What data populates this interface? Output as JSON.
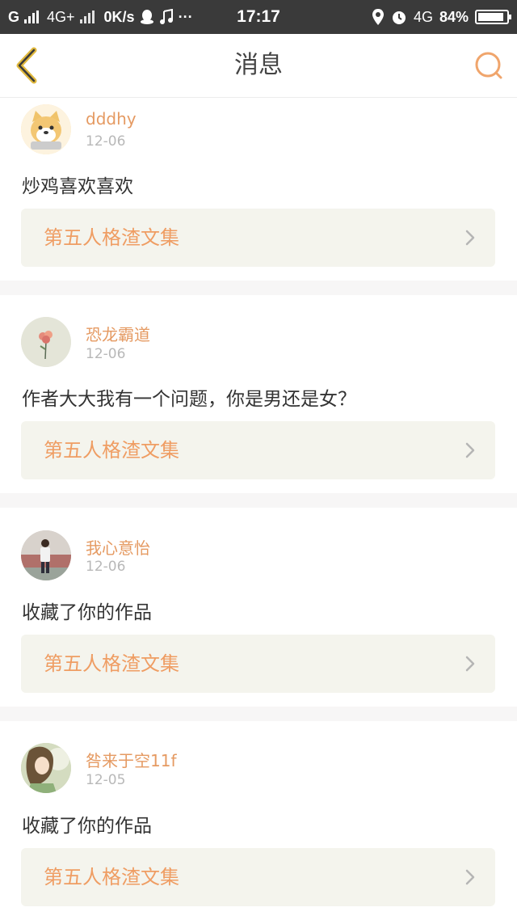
{
  "status_bar": {
    "carrier": "G",
    "network1": "4G+",
    "speed": "0K/s",
    "dots": "···",
    "time": "17:17",
    "network2": "4G",
    "battery": "84%",
    "battery_level": 0.84,
    "icons": [
      "signal-icon",
      "qq-penguin-icon",
      "music-note-icon",
      "location-icon",
      "alarm-icon",
      "battery-icon"
    ]
  },
  "nav": {
    "title": "消息",
    "back_icon": "back-chevron-icon",
    "search_icon": "search-icon",
    "accent": "#e59a62"
  },
  "messages": [
    {
      "username": "dddhy",
      "date": "12-06",
      "text": "炒鸡喜欢喜欢",
      "work": "第五人格渣文集",
      "avatar": "shiba-dog-avatar"
    },
    {
      "username": "恐龙霸道",
      "date": "12-06",
      "text": "作者大大我有一个问题，你是男还是女？",
      "work": "第五人格渣文集",
      "avatar": "flower-avatar"
    },
    {
      "username": "我心意怡",
      "date": "12-06",
      "text": "收藏了你的作品",
      "work": "第五人格渣文集",
      "avatar": "person-photo-avatar"
    },
    {
      "username": "咎来于空11f",
      "date": "12-05",
      "text": "收藏了你的作品",
      "work": "第五人格渣文集",
      "avatar": "anime-girl-avatar"
    }
  ]
}
